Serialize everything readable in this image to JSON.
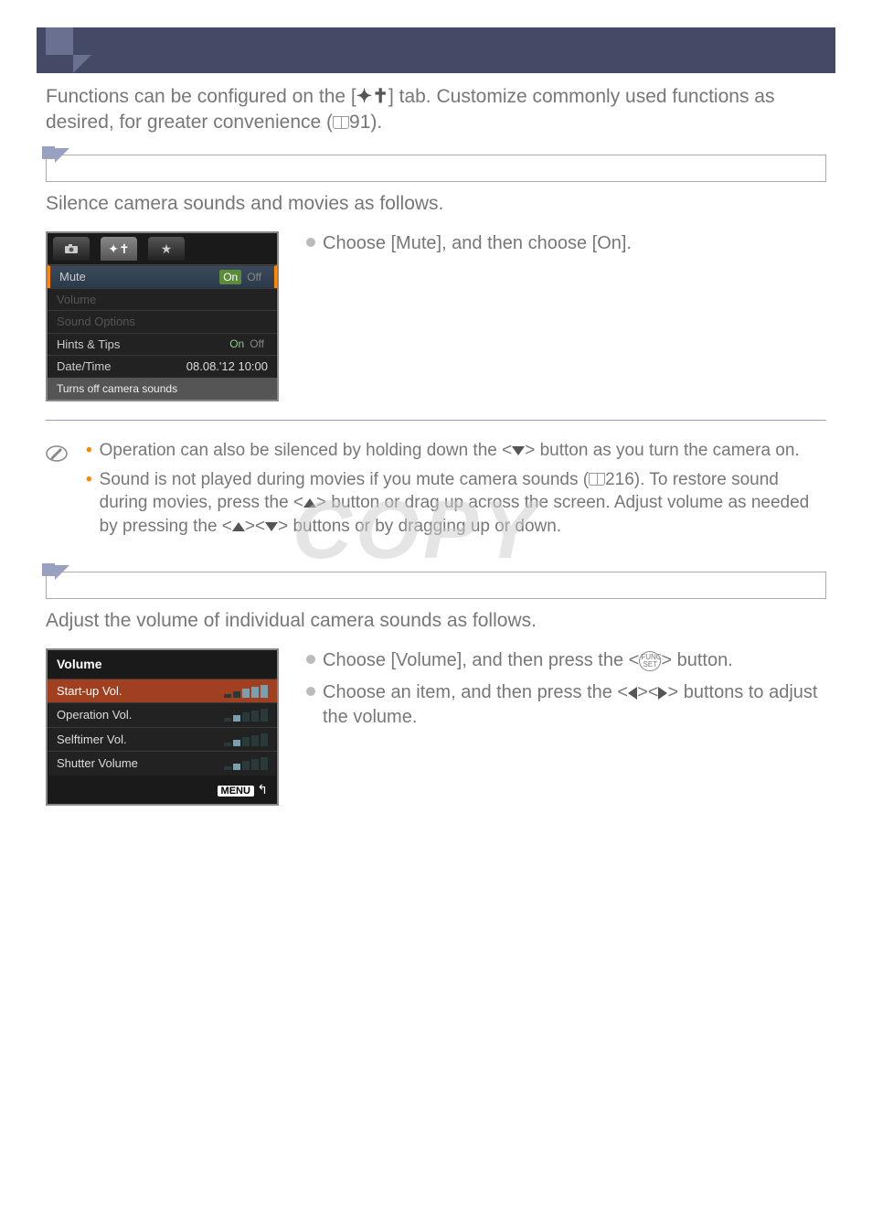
{
  "intro": {
    "part1": "Functions can be configured on the [",
    "part2": "] tab. Customize commonly used functions as desired, for greater convenience (",
    "part3": "91)."
  },
  "watermark": "COPY",
  "section1": {
    "desc": "Silence camera sounds and movies as follows.",
    "instruction1": "Choose [Mute], and then choose [On].",
    "screen": {
      "rows": {
        "mute": {
          "label": "Mute",
          "on": "On",
          "off": "Off"
        },
        "volume": {
          "label": "Volume"
        },
        "sound_options": {
          "label": "Sound Options"
        },
        "hints_tips": {
          "label": "Hints & Tips",
          "on": "On",
          "off": "Off"
        },
        "date_time": {
          "label": "Date/Time",
          "value": "08.08.'12 10:00"
        }
      },
      "footer": "Turns off camera sounds"
    }
  },
  "notes": {
    "n1_a": "Operation can also be silenced by holding down the <",
    "n1_b": "> button as you turn the camera on.",
    "n2_a": "Sound is not played during movies if you mute camera sounds (",
    "n2_b": "216). To restore sound during movies, press the <",
    "n2_c": "> button or drag up across the screen. Adjust volume as needed by pressing the <",
    "n2_d": "><",
    "n2_e": "> buttons or by dragging up or down."
  },
  "section2": {
    "desc": "Adjust the volume of individual camera sounds as follows.",
    "instruction1_a": "Choose [Volume], and then press the <",
    "instruction1_b": "> button.",
    "funcset_top": "FUNC.",
    "funcset_bot": "SET",
    "instruction2_a": "Choose an item, and then press the <",
    "instruction2_b": "><",
    "instruction2_c": "> buttons to adjust the volume.",
    "screen": {
      "title": "Volume",
      "rows": {
        "startup": "Start-up Vol.",
        "operation": "Operation Vol.",
        "selftimer": "Selftimer Vol.",
        "shutter": "Shutter Volume"
      },
      "menu": "MENU"
    }
  }
}
